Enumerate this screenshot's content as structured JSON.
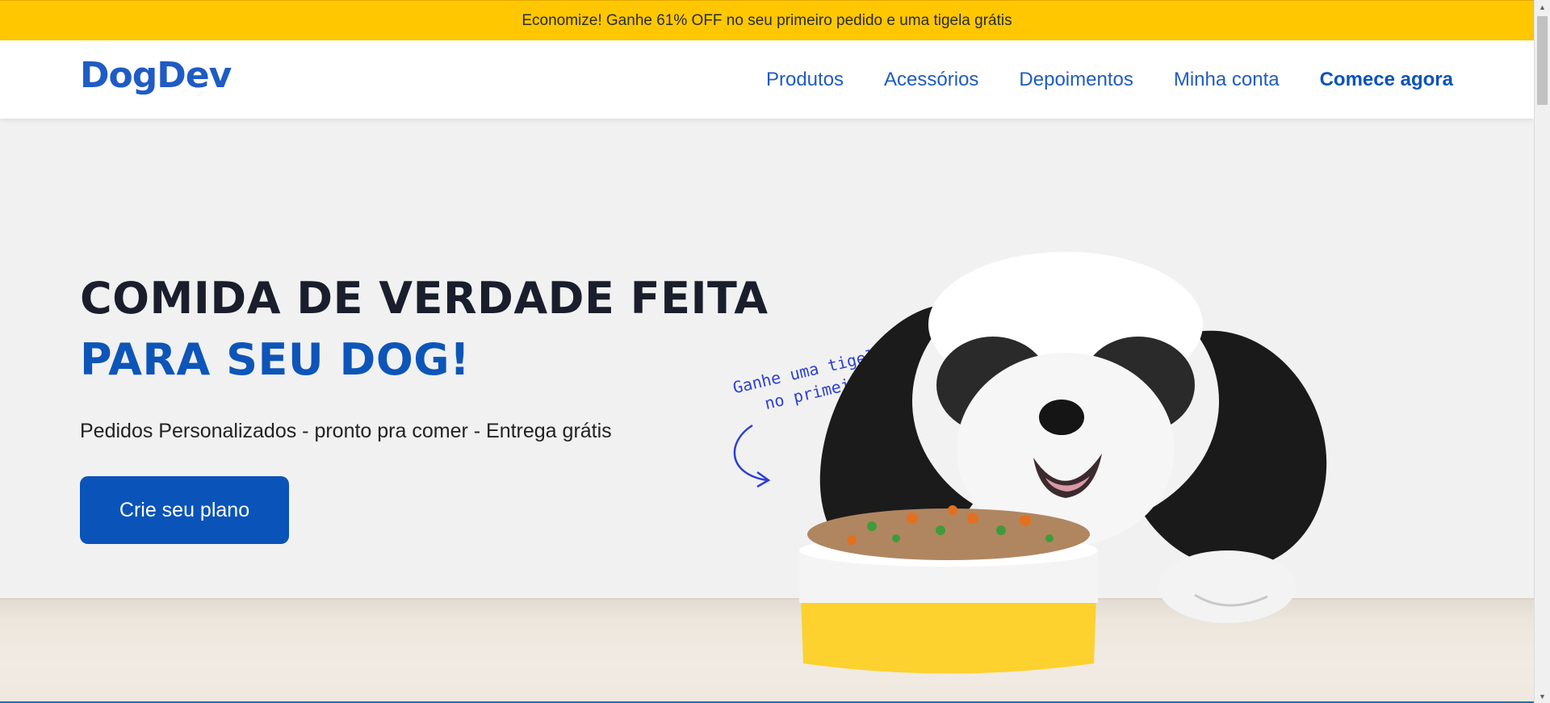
{
  "promo_bar": {
    "text": "Economize! Ganhe 61% OFF no seu primeiro pedido e uma tigela grátis"
  },
  "header": {
    "logo": "DogDev",
    "nav": [
      {
        "label": "Produtos"
      },
      {
        "label": "Acessórios"
      },
      {
        "label": "Depoimentos"
      },
      {
        "label": "Minha conta"
      },
      {
        "label": "Comece agora"
      }
    ]
  },
  "hero": {
    "title_line1": "COMIDA DE VERDADE FEITA",
    "title_line2": "PARA SEU DOG!",
    "subtitle": "Pedidos Personalizados - pronto pra comer - Entrega grátis",
    "cta_label": "Crie seu plano",
    "note_line1": "Ganhe uma tigela grátis",
    "note_line2": "no primeiro pedido."
  },
  "colors": {
    "promo_bg": "#FFC700",
    "brand_blue": "#0d55b8",
    "title_dark": "#1a1e2c",
    "hero_bg": "#f1f1f1",
    "bowl_yellow": "#FDD12E"
  },
  "icons": {
    "note_arrow": "curved-arrow-icon",
    "scroll_up": "scroll-up-arrow-icon",
    "scroll_down": "scroll-down-arrow-icon"
  }
}
